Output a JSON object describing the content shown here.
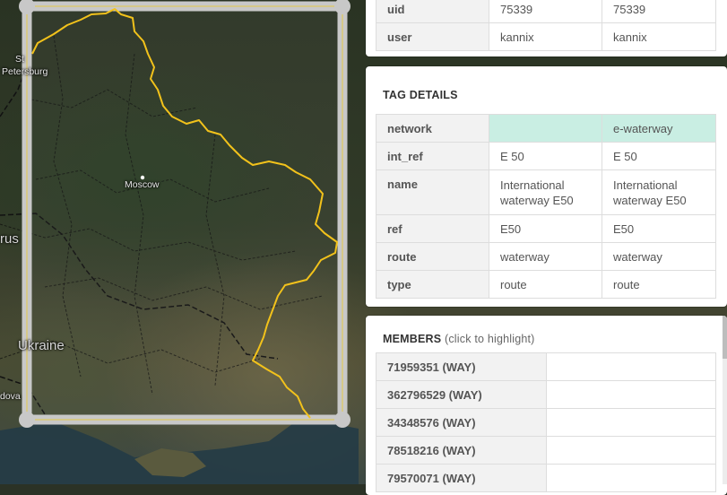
{
  "map": {
    "labels": {
      "st_petersburg_line1": "St",
      "st_petersburg_line2": "Petersburg",
      "moscow": "Moscow",
      "belarus_partial": "rus",
      "ukraine": "Ukraine",
      "moldova_partial": "dova"
    },
    "colors": {
      "route": "#f2c21b",
      "bbox": "#c8c8c8"
    }
  },
  "top_table": {
    "rows": [
      {
        "key": "uid",
        "old": "75339",
        "new": "75339"
      },
      {
        "key": "user",
        "old": "kannix",
        "new": "kannix"
      }
    ]
  },
  "tag_details": {
    "title": "TAG DETAILS",
    "highlight_color": "#c9eee3",
    "rows": [
      {
        "key": "network",
        "old": "",
        "new": "e-waterway"
      },
      {
        "key": "int_ref",
        "old": "E 50",
        "new": "E 50"
      },
      {
        "key": "name",
        "old": "International waterway E50",
        "new": "International waterway E50"
      },
      {
        "key": "ref",
        "old": "E50",
        "new": "E50"
      },
      {
        "key": "route",
        "old": "waterway",
        "new": "waterway"
      },
      {
        "key": "type",
        "old": "route",
        "new": "route"
      }
    ]
  },
  "members": {
    "title": "MEMBERS",
    "note": "(click to highlight)",
    "items": [
      {
        "label": "71959351 (WAY)",
        "value": ""
      },
      {
        "label": "362796529 (WAY)",
        "value": ""
      },
      {
        "label": "34348576 (WAY)",
        "value": ""
      },
      {
        "label": "78518216 (WAY)",
        "value": ""
      },
      {
        "label": "79570071 (WAY)",
        "value": ""
      }
    ]
  }
}
